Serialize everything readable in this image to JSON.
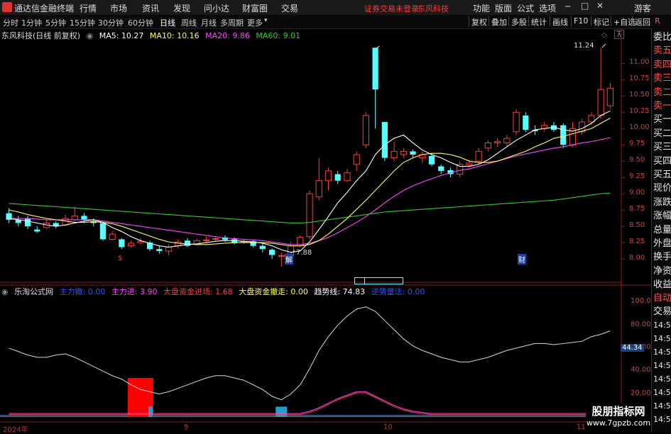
{
  "app": {
    "title": "通达信金融终端",
    "menu": [
      "行情",
      "市场",
      "资讯",
      "发现",
      "问小达",
      "财富圈",
      "交易"
    ],
    "warning": "证券交易未登录",
    "stock_name": "东风科技",
    "right_menu": [
      "功能",
      "版面",
      "公式",
      "选项"
    ],
    "guest": "游客"
  },
  "periods": [
    "分时",
    "1分钟",
    "5分钟",
    "15分钟",
    "30分钟",
    "60分钟",
    "日线",
    "周线",
    "月线",
    "多周期",
    "更多"
  ],
  "active_period": "日线",
  "tools": [
    "复权",
    "叠加",
    "多股",
    "统计",
    "画线",
    "F10",
    "标记",
    "+自选",
    "返回"
  ],
  "icons": {
    "logo": "logo-icon",
    "r": "R"
  },
  "main_legend": {
    "name": "东风科技(日线 前复权)",
    "ma5": "MA5: 10.27",
    "ma10": "MA10: 10.16",
    "ma20": "MA20: 9.86",
    "ma60": "MA60: 9.01"
  },
  "sub_legend": {
    "name": "乐淘公式网",
    "zljc": "主力撤: 0.00",
    "zlj": "主力进: 3.90",
    "dpjr": "大盘资金进场: 1.68",
    "dpcz": "大盘资金撤走: 0.00",
    "qsx": "趋势线: 74.83",
    "tdjs": "逆势量法: 0.00"
  },
  "price_axis": [
    "11.00",
    "10.75",
    "10.50",
    "10.25",
    "10.00",
    "9.75",
    "9.50",
    "9.25",
    "9.00",
    "8.75",
    "8.50",
    "8.25",
    "8.00"
  ],
  "sub_axis": [
    "100.0",
    "80.00",
    "60.00",
    "40.00",
    "20.00"
  ],
  "sub_current": "44.34",
  "high_label": "11.24",
  "low_label": "7.88",
  "markers": {
    "s": "$",
    "dong": "解",
    "cai": "财"
  },
  "date_axis": {
    "y2024": "2024年",
    "m9": "9",
    "m10": "10",
    "m11": "11"
  },
  "right_side": [
    "委比",
    "卖五",
    "卖四",
    "卖三",
    "卖二",
    "卖一",
    "买一",
    "买二",
    "买三",
    "买四",
    "买五",
    "现价",
    "涨跌",
    "涨幅",
    "总量",
    "外盘",
    "换手",
    "净资",
    "收益"
  ],
  "right_side2": [
    "自动",
    "交易",
    "14:56",
    "14:56",
    "14:56",
    "14:56",
    "14:56",
    "14:56",
    "14:56",
    "14:56"
  ],
  "watermark": {
    "line1": "股朋指标网",
    "line2": "www.7gpzb.com"
  },
  "colors": {
    "up": "#ff3b3b",
    "down": "#54ffff",
    "ma5": "#ffffff",
    "ma10": "#ffff55",
    "ma20": "#ff44ff",
    "ma60": "#33cc33"
  },
  "chart_data": {
    "type": "candlestick",
    "ylim": [
      7.75,
      11.45
    ],
    "candles": [
      {
        "o": 8.7,
        "c": 8.6,
        "h": 8.78,
        "l": 8.55
      },
      {
        "o": 8.6,
        "c": 8.55,
        "h": 8.66,
        "l": 8.5
      },
      {
        "o": 8.62,
        "c": 8.5,
        "h": 8.66,
        "l": 8.46
      },
      {
        "o": 8.45,
        "c": 8.42,
        "h": 8.5,
        "l": 8.4
      },
      {
        "o": 8.48,
        "c": 8.55,
        "h": 8.6,
        "l": 8.46
      },
      {
        "o": 8.55,
        "c": 8.5,
        "h": 8.58,
        "l": 8.47
      },
      {
        "o": 8.52,
        "c": 8.62,
        "h": 8.68,
        "l": 8.5
      },
      {
        "o": 8.6,
        "c": 8.66,
        "h": 8.8,
        "l": 8.58
      },
      {
        "o": 8.66,
        "c": 8.6,
        "h": 8.7,
        "l": 8.55
      },
      {
        "o": 8.58,
        "c": 8.55,
        "h": 8.62,
        "l": 8.5
      },
      {
        "o": 8.55,
        "c": 8.3,
        "h": 8.57,
        "l": 8.28
      },
      {
        "o": 8.3,
        "c": 8.38,
        "h": 8.42,
        "l": 8.28
      },
      {
        "o": 8.3,
        "c": 8.18,
        "h": 8.32,
        "l": 8.15
      },
      {
        "o": 8.2,
        "c": 8.24,
        "h": 8.28,
        "l": 8.18
      },
      {
        "o": 8.25,
        "c": 8.27,
        "h": 8.32,
        "l": 8.22
      },
      {
        "o": 8.25,
        "c": 8.15,
        "h": 8.28,
        "l": 8.12
      },
      {
        "o": 8.15,
        "c": 8.12,
        "h": 8.2,
        "l": 8.08
      },
      {
        "o": 8.12,
        "c": 8.18,
        "h": 8.22,
        "l": 8.05
      },
      {
        "o": 8.2,
        "c": 8.26,
        "h": 8.3,
        "l": 8.16
      },
      {
        "o": 8.28,
        "c": 8.2,
        "h": 8.32,
        "l": 8.18
      },
      {
        "o": 8.22,
        "c": 8.28,
        "h": 8.31,
        "l": 8.2
      },
      {
        "o": 8.28,
        "c": 8.29,
        "h": 8.34,
        "l": 8.26
      },
      {
        "o": 8.3,
        "c": 8.31,
        "h": 8.35,
        "l": 8.27
      },
      {
        "o": 8.33,
        "c": 8.29,
        "h": 8.36,
        "l": 8.26
      },
      {
        "o": 8.3,
        "c": 8.24,
        "h": 8.33,
        "l": 8.22
      },
      {
        "o": 8.26,
        "c": 8.27,
        "h": 8.3,
        "l": 8.23
      },
      {
        "o": 8.27,
        "c": 8.2,
        "h": 8.3,
        "l": 8.18
      },
      {
        "o": 8.2,
        "c": 8.15,
        "h": 8.24,
        "l": 8.1
      },
      {
        "o": 8.14,
        "c": 8.06,
        "h": 8.16,
        "l": 8.0
      },
      {
        "o": 8.05,
        "c": 8.05,
        "h": 8.1,
        "l": 7.88
      },
      {
        "o": 8.05,
        "c": 8.2,
        "h": 8.26,
        "l": 8.02
      },
      {
        "o": 8.2,
        "c": 8.33,
        "h": 8.36,
        "l": 8.18
      },
      {
        "o": 8.34,
        "c": 9.0,
        "h": 9.05,
        "l": 8.3
      },
      {
        "o": 8.95,
        "c": 9.2,
        "h": 9.55,
        "l": 8.9
      },
      {
        "o": 9.2,
        "c": 9.35,
        "h": 9.4,
        "l": 9.05
      },
      {
        "o": 9.3,
        "c": 9.2,
        "h": 9.35,
        "l": 9.15
      },
      {
        "o": 9.2,
        "c": 9.32,
        "h": 9.38,
        "l": 9.18
      },
      {
        "o": 9.45,
        "c": 9.6,
        "h": 9.65,
        "l": 9.35
      },
      {
        "o": 9.75,
        "c": 10.2,
        "h": 10.25,
        "l": 9.7
      },
      {
        "o": 11.24,
        "c": 10.6,
        "h": 11.24,
        "l": 10.0
      },
      {
        "o": 10.1,
        "c": 9.55,
        "h": 10.1,
        "l": 9.5
      },
      {
        "o": 9.55,
        "c": 9.65,
        "h": 9.8,
        "l": 9.5
      },
      {
        "o": 9.6,
        "c": 9.65,
        "h": 9.7,
        "l": 9.55
      },
      {
        "o": 9.65,
        "c": 9.6,
        "h": 9.68,
        "l": 9.55
      },
      {
        "o": 9.55,
        "c": 9.6,
        "h": 9.65,
        "l": 9.48
      },
      {
        "o": 9.58,
        "c": 9.45,
        "h": 9.62,
        "l": 9.42
      },
      {
        "o": 9.42,
        "c": 9.35,
        "h": 9.45,
        "l": 9.3
      },
      {
        "o": 9.36,
        "c": 9.3,
        "h": 9.4,
        "l": 9.25
      },
      {
        "o": 9.3,
        "c": 9.45,
        "h": 9.5,
        "l": 9.25
      },
      {
        "o": 9.44,
        "c": 9.47,
        "h": 9.52,
        "l": 9.4
      },
      {
        "o": 9.5,
        "c": 9.65,
        "h": 9.7,
        "l": 9.45
      },
      {
        "o": 9.7,
        "c": 9.78,
        "h": 9.82,
        "l": 9.65
      },
      {
        "o": 9.78,
        "c": 9.8,
        "h": 9.85,
        "l": 9.72
      },
      {
        "o": 9.78,
        "c": 9.85,
        "h": 9.9,
        "l": 9.72
      },
      {
        "o": 9.95,
        "c": 10.25,
        "h": 10.3,
        "l": 9.9
      },
      {
        "o": 10.2,
        "c": 9.98,
        "h": 10.25,
        "l": 9.95
      },
      {
        "o": 9.98,
        "c": 9.96,
        "h": 10.05,
        "l": 9.9
      },
      {
        "o": 10.0,
        "c": 10.05,
        "h": 10.1,
        "l": 9.95
      },
      {
        "o": 10.05,
        "c": 9.98,
        "h": 10.1,
        "l": 9.95
      },
      {
        "o": 10.05,
        "c": 9.75,
        "h": 10.08,
        "l": 9.7
      },
      {
        "o": 9.75,
        "c": 10.0,
        "h": 10.1,
        "l": 9.72
      },
      {
        "o": 9.95,
        "c": 10.1,
        "h": 10.15,
        "l": 9.9
      },
      {
        "o": 10.1,
        "c": 10.2,
        "h": 10.25,
        "l": 10.05
      },
      {
        "o": 10.2,
        "c": 10.6,
        "h": 11.24,
        "l": 10.15
      },
      {
        "o": 10.35,
        "c": 10.62,
        "h": 10.7,
        "l": 10.3
      }
    ],
    "ma5": [
      8.62,
      8.6,
      8.58,
      8.55,
      8.52,
      8.5,
      8.52,
      8.55,
      8.58,
      8.6,
      8.56,
      8.48,
      8.42,
      8.34,
      8.28,
      8.24,
      8.2,
      8.18,
      8.2,
      8.22,
      8.23,
      8.25,
      8.27,
      8.28,
      8.28,
      8.27,
      8.26,
      8.24,
      8.2,
      8.14,
      8.1,
      8.12,
      8.26,
      8.45,
      8.65,
      8.86,
      9.02,
      9.2,
      9.35,
      9.6,
      9.75,
      9.85,
      9.9,
      9.78,
      9.67,
      9.6,
      9.55,
      9.48,
      9.42,
      9.42,
      9.45,
      9.52,
      9.62,
      9.72,
      9.82,
      9.9,
      9.98,
      10.0,
      10.02,
      9.98,
      9.96,
      10.0,
      10.08,
      10.2,
      10.27
    ],
    "ma10": [
      8.75,
      8.72,
      8.68,
      8.65,
      8.62,
      8.6,
      8.58,
      8.56,
      8.56,
      8.57,
      8.56,
      8.54,
      8.5,
      8.45,
      8.4,
      8.35,
      8.3,
      8.26,
      8.24,
      8.23,
      8.22,
      8.22,
      8.23,
      8.24,
      8.25,
      8.25,
      8.25,
      8.25,
      8.24,
      8.22,
      8.2,
      8.2,
      8.22,
      8.28,
      8.38,
      8.5,
      8.62,
      8.76,
      8.9,
      9.05,
      9.2,
      9.35,
      9.48,
      9.55,
      9.6,
      9.62,
      9.62,
      9.6,
      9.56,
      9.5,
      9.48,
      9.48,
      9.5,
      9.55,
      9.6,
      9.65,
      9.72,
      9.78,
      9.85,
      9.88,
      9.92,
      9.96,
      10.0,
      10.08,
      10.16
    ],
    "ma20": [
      8.62,
      8.62,
      8.62,
      8.61,
      8.6,
      8.6,
      8.6,
      8.6,
      8.6,
      8.6,
      8.58,
      8.56,
      8.54,
      8.52,
      8.5,
      8.48,
      8.46,
      8.44,
      8.42,
      8.4,
      8.38,
      8.36,
      8.34,
      8.32,
      8.31,
      8.3,
      8.29,
      8.28,
      8.26,
      8.24,
      8.22,
      8.22,
      8.24,
      8.28,
      8.33,
      8.4,
      8.48,
      8.56,
      8.65,
      8.75,
      8.86,
      8.96,
      9.05,
      9.12,
      9.18,
      9.23,
      9.28,
      9.32,
      9.36,
      9.38,
      9.42,
      9.46,
      9.5,
      9.54,
      9.58,
      9.61,
      9.64,
      9.67,
      9.7,
      9.72,
      9.75,
      9.78,
      9.8,
      9.83,
      9.86
    ],
    "ma60": [
      8.85,
      8.84,
      8.83,
      8.82,
      8.81,
      8.8,
      8.79,
      8.78,
      8.77,
      8.76,
      8.75,
      8.74,
      8.73,
      8.72,
      8.71,
      8.7,
      8.69,
      8.68,
      8.67,
      8.66,
      8.65,
      8.64,
      8.63,
      8.62,
      8.61,
      8.6,
      8.59,
      8.58,
      8.57,
      8.56,
      8.55,
      8.55,
      8.56,
      8.58,
      8.6,
      8.62,
      8.64,
      8.66,
      8.68,
      8.7,
      8.72,
      8.73,
      8.74,
      8.75,
      8.76,
      8.77,
      8.78,
      8.79,
      8.8,
      8.81,
      8.82,
      8.83,
      8.84,
      8.85,
      8.86,
      8.87,
      8.88,
      8.89,
      8.9,
      8.92,
      8.94,
      8.96,
      8.98,
      9.0,
      9.01
    ],
    "sub": {
      "ylim": [
        0,
        110
      ],
      "trend": [
        60,
        57,
        54,
        52,
        52,
        54,
        55,
        52,
        48,
        44,
        40,
        36,
        33,
        28,
        24,
        22,
        20,
        22,
        25,
        28,
        31,
        34,
        36,
        36,
        34,
        32,
        28,
        24,
        18,
        15,
        20,
        28,
        42,
        58,
        70,
        80,
        88,
        94,
        96,
        92,
        84,
        76,
        68,
        62,
        58,
        55,
        52,
        50,
        48,
        48,
        50,
        52,
        55,
        58,
        60,
        62,
        64,
        64,
        63,
        64,
        65,
        66,
        70,
        72,
        75
      ],
      "red": [
        {
          "i": 14,
          "v": 34
        }
      ],
      "cyan": [
        {
          "i": 15,
          "v": 9
        },
        {
          "i": 29,
          "v": 9
        }
      ],
      "magenta": [
        3,
        3,
        3,
        3,
        3,
        3,
        3,
        3,
        3,
        3,
        3,
        3,
        3,
        3,
        3,
        3,
        3,
        3,
        3,
        3,
        3,
        3,
        3,
        3,
        3,
        3,
        3,
        3,
        3,
        3,
        3,
        3,
        5,
        8,
        12,
        16,
        19,
        22,
        22,
        18,
        14,
        10,
        7,
        5,
        4,
        3,
        3,
        3,
        3,
        3,
        3,
        3,
        3,
        3,
        3,
        3,
        3,
        3,
        3,
        3,
        3,
        3,
        3,
        3,
        3
      ]
    }
  }
}
